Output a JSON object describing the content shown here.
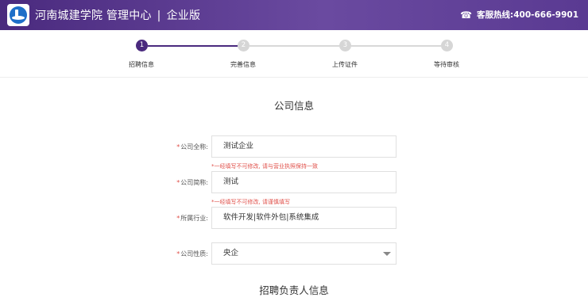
{
  "header": {
    "title_school": "河南城建学院 管理中心",
    "title_sep": "|",
    "title_edition": "企业版",
    "hotline_label": "客服热线:",
    "hotline_number": "400-666-9901",
    "phone_icon": "☎",
    "brand_color": "#4a2a7e"
  },
  "steps": [
    {
      "num": "1",
      "label": "招聘信息",
      "active": true
    },
    {
      "num": "2",
      "label": "完善信息",
      "active": false
    },
    {
      "num": "3",
      "label": "上传证件",
      "active": false
    },
    {
      "num": "4",
      "label": "等待审核",
      "active": false
    }
  ],
  "company_section": {
    "title": "公司信息",
    "full_name": {
      "required_mark": "*",
      "label": "公司全称:",
      "value": "测试企业",
      "hint": "*一经填写不可修改, 请与营业执照保持一致"
    },
    "short_name": {
      "required_mark": "*",
      "label": "公司简称:",
      "value": "测试",
      "hint": "*一经填写不可修改, 请谨慎填写"
    },
    "industry": {
      "required_mark": "*",
      "label": "所属行业:",
      "value": "软件开发|软件外包|系统集成"
    },
    "nature": {
      "required_mark": "*",
      "label": "公司性质:",
      "value": "央企"
    }
  },
  "recruiter_section": {
    "title": "招聘负责人信息"
  }
}
